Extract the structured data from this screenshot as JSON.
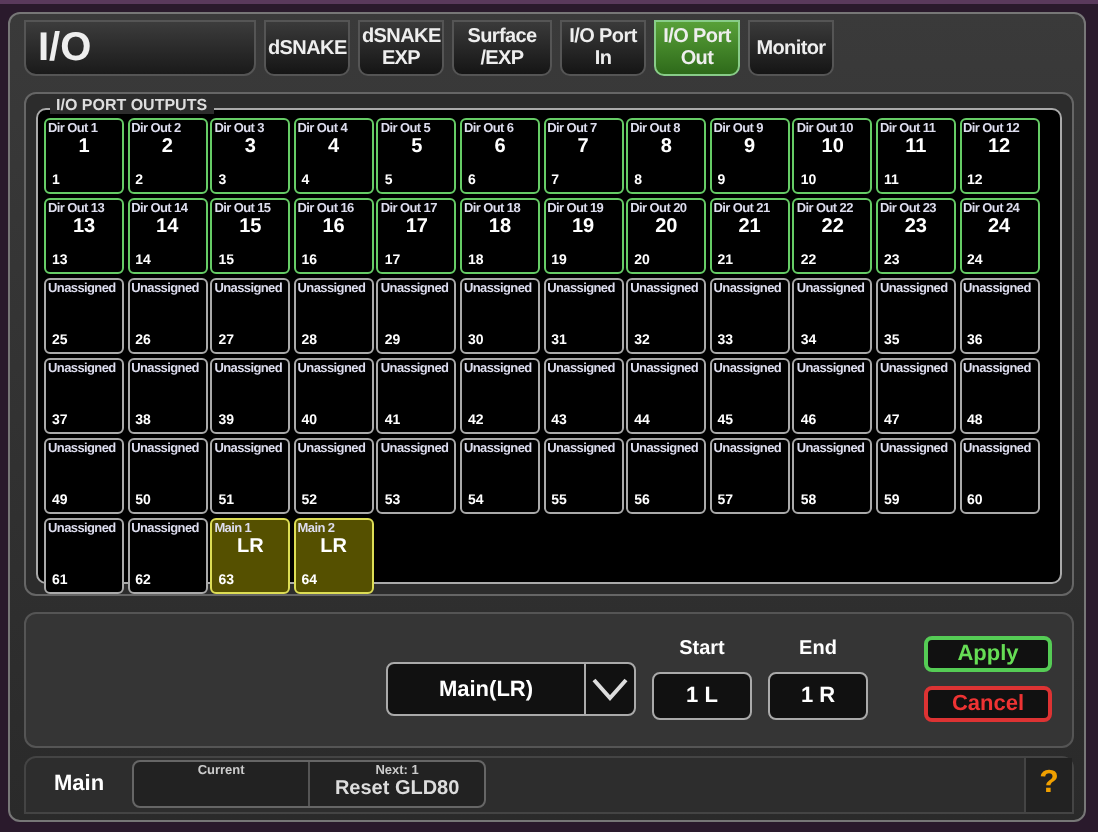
{
  "window": {
    "title": "I/O"
  },
  "tabs": [
    {
      "label": "dSNAKE",
      "selected": false
    },
    {
      "label": "dSNAKE EXP",
      "selected": false
    },
    {
      "label": "Surface /EXP",
      "selected": false
    },
    {
      "label": "I/O Port In",
      "selected": false
    },
    {
      "label": "I/O Port Out",
      "selected": true
    },
    {
      "label": "Monitor",
      "selected": false
    }
  ],
  "panel": {
    "title": "I/O PORT OUTPUTS",
    "cells": [
      {
        "kind": "dir",
        "label": "Dir Out 1",
        "value": "1",
        "number": "1"
      },
      {
        "kind": "dir",
        "label": "Dir Out 2",
        "value": "2",
        "number": "2"
      },
      {
        "kind": "dir",
        "label": "Dir Out 3",
        "value": "3",
        "number": "3"
      },
      {
        "kind": "dir",
        "label": "Dir Out 4",
        "value": "4",
        "number": "4"
      },
      {
        "kind": "dir",
        "label": "Dir Out 5",
        "value": "5",
        "number": "5"
      },
      {
        "kind": "dir",
        "label": "Dir Out 6",
        "value": "6",
        "number": "6"
      },
      {
        "kind": "dir",
        "label": "Dir Out 7",
        "value": "7",
        "number": "7"
      },
      {
        "kind": "dir",
        "label": "Dir Out 8",
        "value": "8",
        "number": "8"
      },
      {
        "kind": "dir",
        "label": "Dir Out 9",
        "value": "9",
        "number": "9"
      },
      {
        "kind": "dir",
        "label": "Dir Out 10",
        "value": "10",
        "number": "10"
      },
      {
        "kind": "dir",
        "label": "Dir Out 11",
        "value": "11",
        "number": "11"
      },
      {
        "kind": "dir",
        "label": "Dir Out 12",
        "value": "12",
        "number": "12"
      },
      {
        "kind": "dir",
        "label": "Dir Out 13",
        "value": "13",
        "number": "13"
      },
      {
        "kind": "dir",
        "label": "Dir Out 14",
        "value": "14",
        "number": "14"
      },
      {
        "kind": "dir",
        "label": "Dir Out 15",
        "value": "15",
        "number": "15"
      },
      {
        "kind": "dir",
        "label": "Dir Out 16",
        "value": "16",
        "number": "16"
      },
      {
        "kind": "dir",
        "label": "Dir Out 17",
        "value": "17",
        "number": "17"
      },
      {
        "kind": "dir",
        "label": "Dir Out 18",
        "value": "18",
        "number": "18"
      },
      {
        "kind": "dir",
        "label": "Dir Out 19",
        "value": "19",
        "number": "19"
      },
      {
        "kind": "dir",
        "label": "Dir Out 20",
        "value": "20",
        "number": "20"
      },
      {
        "kind": "dir",
        "label": "Dir Out 21",
        "value": "21",
        "number": "21"
      },
      {
        "kind": "dir",
        "label": "Dir Out 22",
        "value": "22",
        "number": "22"
      },
      {
        "kind": "dir",
        "label": "Dir Out 23",
        "value": "23",
        "number": "23"
      },
      {
        "kind": "dir",
        "label": "Dir Out 24",
        "value": "24",
        "number": "24"
      },
      {
        "kind": "unassigned",
        "label": "Unassigned",
        "number": "25"
      },
      {
        "kind": "unassigned",
        "label": "Unassigned",
        "number": "26"
      },
      {
        "kind": "unassigned",
        "label": "Unassigned",
        "number": "27"
      },
      {
        "kind": "unassigned",
        "label": "Unassigned",
        "number": "28"
      },
      {
        "kind": "unassigned",
        "label": "Unassigned",
        "number": "29"
      },
      {
        "kind": "unassigned",
        "label": "Unassigned",
        "number": "30"
      },
      {
        "kind": "unassigned",
        "label": "Unassigned",
        "number": "31"
      },
      {
        "kind": "unassigned",
        "label": "Unassigned",
        "number": "32"
      },
      {
        "kind": "unassigned",
        "label": "Unassigned",
        "number": "33"
      },
      {
        "kind": "unassigned",
        "label": "Unassigned",
        "number": "34"
      },
      {
        "kind": "unassigned",
        "label": "Unassigned",
        "number": "35"
      },
      {
        "kind": "unassigned",
        "label": "Unassigned",
        "number": "36"
      },
      {
        "kind": "unassigned",
        "label": "Unassigned",
        "number": "37"
      },
      {
        "kind": "unassigned",
        "label": "Unassigned",
        "number": "38"
      },
      {
        "kind": "unassigned",
        "label": "Unassigned",
        "number": "39"
      },
      {
        "kind": "unassigned",
        "label": "Unassigned",
        "number": "40"
      },
      {
        "kind": "unassigned",
        "label": "Unassigned",
        "number": "41"
      },
      {
        "kind": "unassigned",
        "label": "Unassigned",
        "number": "42"
      },
      {
        "kind": "unassigned",
        "label": "Unassigned",
        "number": "43"
      },
      {
        "kind": "unassigned",
        "label": "Unassigned",
        "number": "44"
      },
      {
        "kind": "unassigned",
        "label": "Unassigned",
        "number": "45"
      },
      {
        "kind": "unassigned",
        "label": "Unassigned",
        "number": "46"
      },
      {
        "kind": "unassigned",
        "label": "Unassigned",
        "number": "47"
      },
      {
        "kind": "unassigned",
        "label": "Unassigned",
        "number": "48"
      },
      {
        "kind": "unassigned",
        "label": "Unassigned",
        "number": "49"
      },
      {
        "kind": "unassigned",
        "label": "Unassigned",
        "number": "50"
      },
      {
        "kind": "unassigned",
        "label": "Unassigned",
        "number": "51"
      },
      {
        "kind": "unassigned",
        "label": "Unassigned",
        "number": "52"
      },
      {
        "kind": "unassigned",
        "label": "Unassigned",
        "number": "53"
      },
      {
        "kind": "unassigned",
        "label": "Unassigned",
        "number": "54"
      },
      {
        "kind": "unassigned",
        "label": "Unassigned",
        "number": "55"
      },
      {
        "kind": "unassigned",
        "label": "Unassigned",
        "number": "56"
      },
      {
        "kind": "unassigned",
        "label": "Unassigned",
        "number": "57"
      },
      {
        "kind": "unassigned",
        "label": "Unassigned",
        "number": "58"
      },
      {
        "kind": "unassigned",
        "label": "Unassigned",
        "number": "59"
      },
      {
        "kind": "unassigned",
        "label": "Unassigned",
        "number": "60"
      },
      {
        "kind": "unassigned",
        "label": "Unassigned",
        "number": "61"
      },
      {
        "kind": "unassigned",
        "label": "Unassigned",
        "number": "62"
      },
      {
        "kind": "main",
        "label": "Main 1",
        "value": "LR",
        "number": "63"
      },
      {
        "kind": "main",
        "label": "Main 2",
        "value": "LR",
        "number": "64"
      }
    ]
  },
  "assign": {
    "source": "Main(LR)",
    "start_label": "Start",
    "start": "1 L",
    "end_label": "End",
    "end": "1 R",
    "buttons": [
      {
        "kind": "apply",
        "label": "Apply"
      },
      {
        "kind": "cancel",
        "label": "Cancel"
      }
    ]
  },
  "status_bar": {
    "mode": "Main",
    "current_label": "Current",
    "next_label": "Next: 1",
    "next": "Reset GLD80",
    "help": "?"
  }
}
